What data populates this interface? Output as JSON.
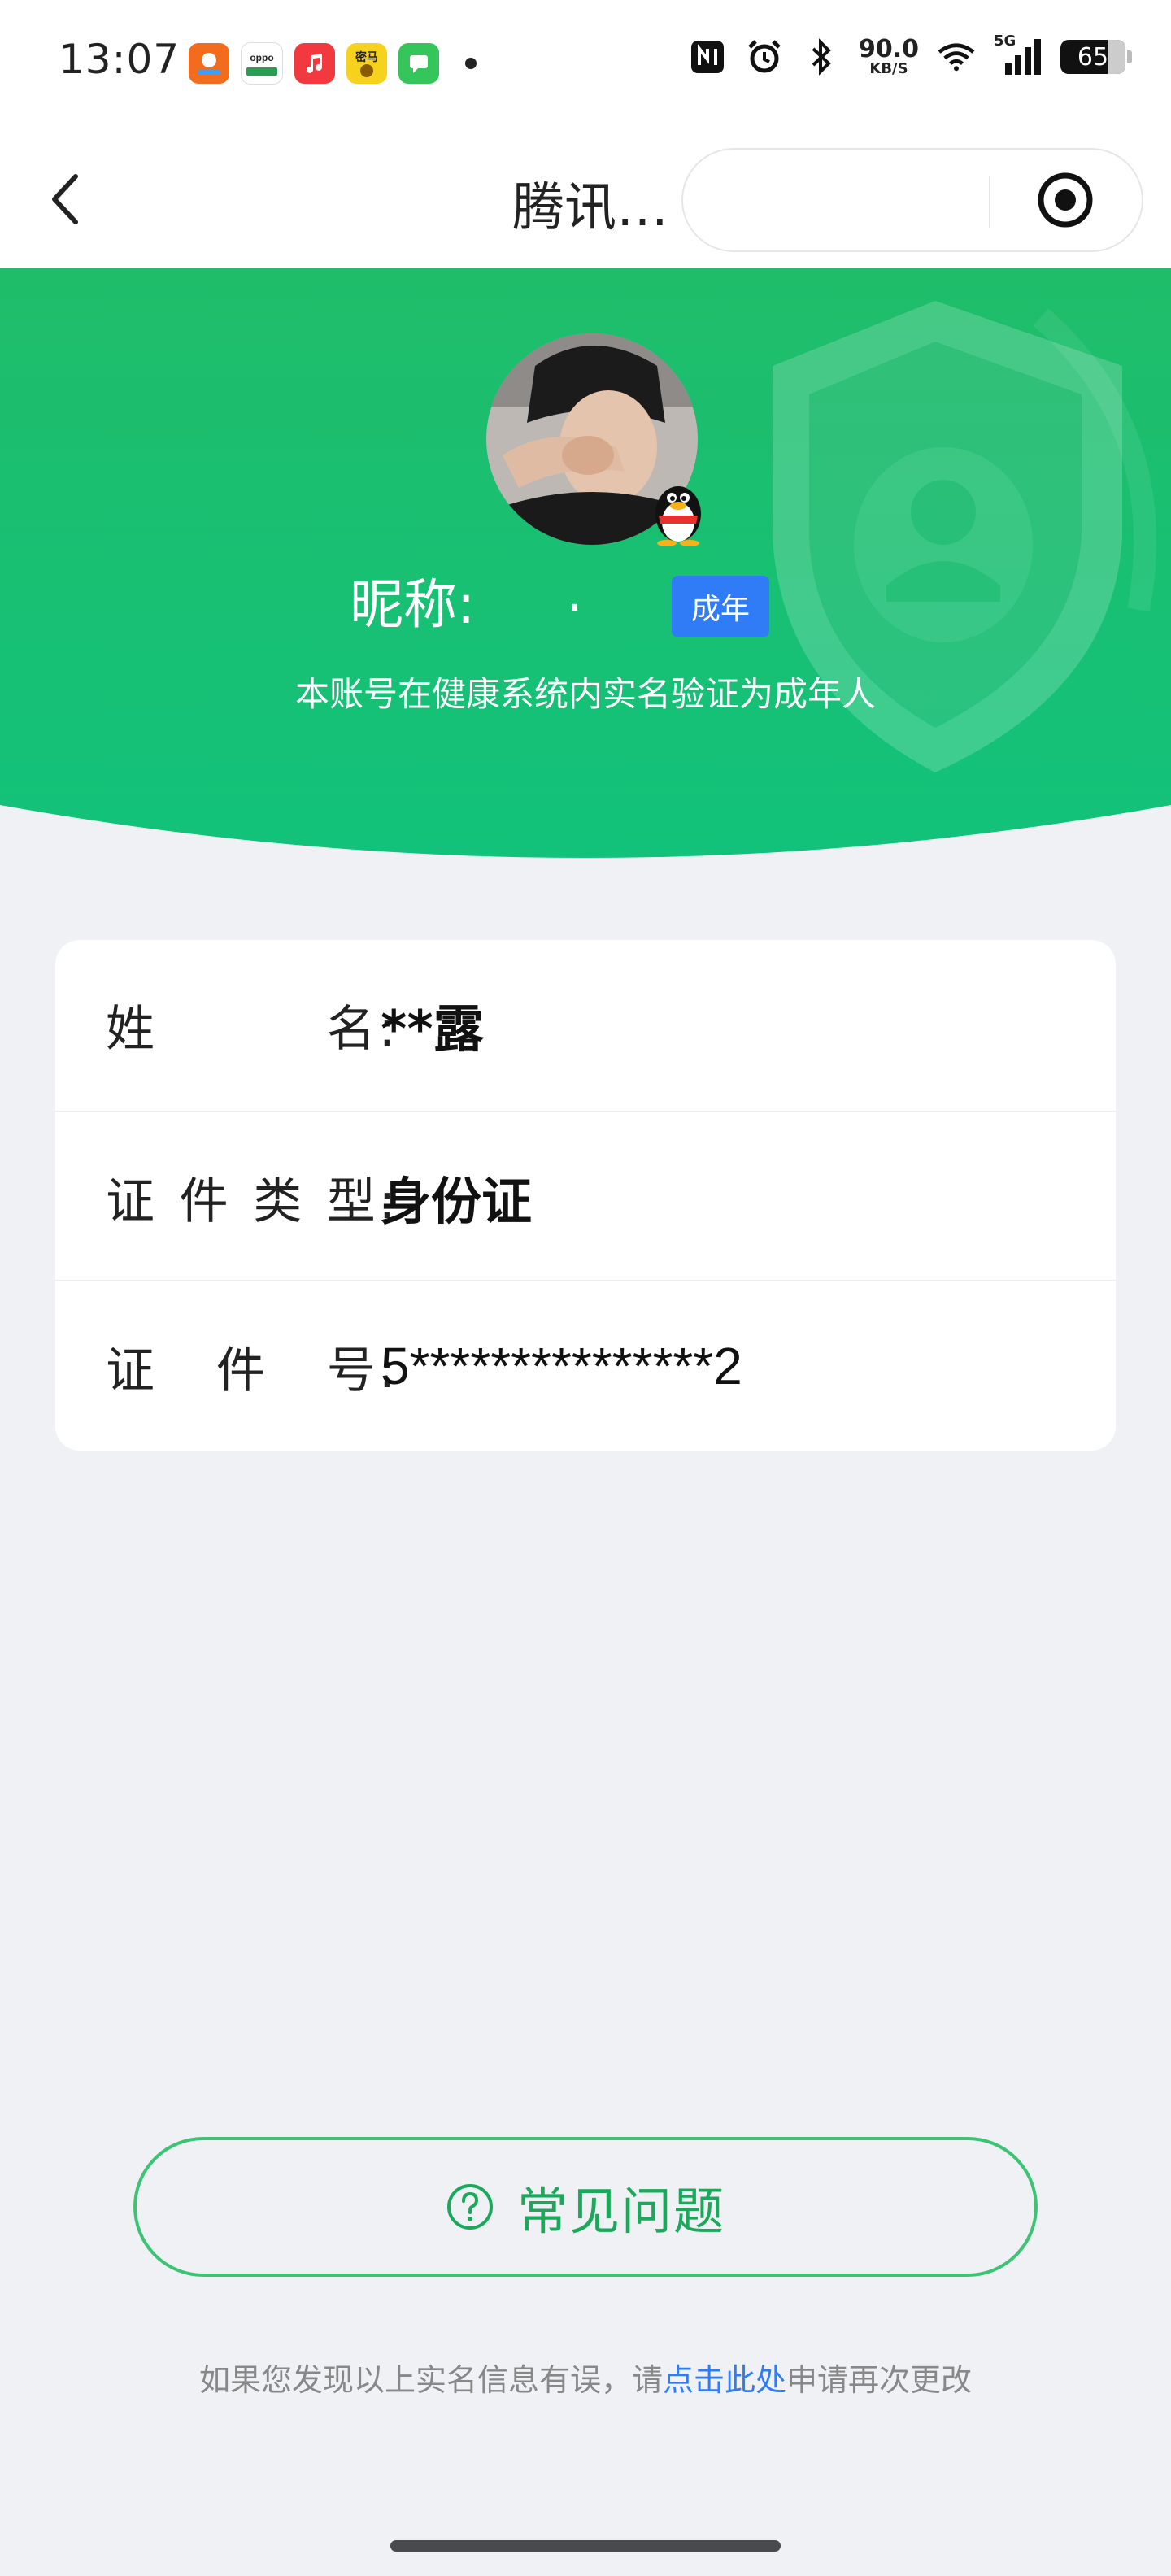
{
  "status_bar": {
    "time": "13:07",
    "app_icons": [
      {
        "name": "app-1",
        "color": "#f36c1e"
      },
      {
        "name": "app-oppo",
        "color": "#2b9c51",
        "label": "oppo"
      },
      {
        "name": "app-music",
        "color": "#f2393f"
      },
      {
        "name": "app-yellow",
        "color": "#f6d21d",
        "label": "密马"
      },
      {
        "name": "app-messages",
        "color": "#35c55b"
      }
    ],
    "net_speed": "90.0",
    "net_speed_unit": "KB/S",
    "network": "5G",
    "battery": "65"
  },
  "nav": {
    "title": "腾讯…"
  },
  "header": {
    "nickname_label": "昵称:",
    "nickname_value": ".",
    "adult_badge": "成年",
    "description": "本账号在健康系统内实名验证为成年人",
    "colors": {
      "green_top": "#1fbd6a",
      "green_bottom": "#12c27a"
    }
  },
  "info": {
    "rows": [
      {
        "label_chars": [
          "姓",
          "名"
        ],
        "value": "**露"
      },
      {
        "label_chars": [
          "证",
          "件",
          "类",
          "型"
        ],
        "value": "身份证"
      },
      {
        "label_chars": [
          "证",
          "件",
          "号"
        ],
        "value": "5***************2"
      }
    ],
    "colon": ":"
  },
  "faq": {
    "label": "常见问题",
    "accent": "#1ba85a"
  },
  "footer": {
    "prefix": "如果您发现以上实名信息有误，请",
    "link": "点击此处",
    "suffix": "申请再次更改"
  }
}
